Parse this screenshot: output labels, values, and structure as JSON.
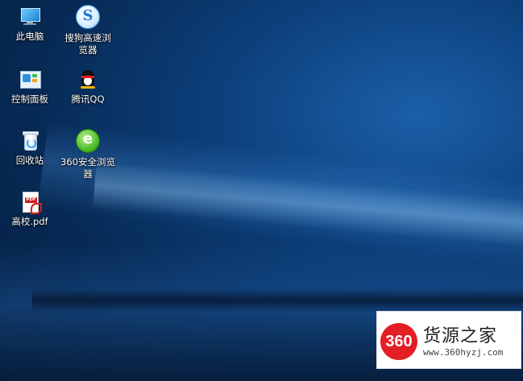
{
  "desktop": {
    "icons": [
      {
        "id": "this-pc",
        "label": "此电脑"
      },
      {
        "id": "sogou-browser",
        "label": "搜狗高速浏览器"
      },
      {
        "id": "control-panel",
        "label": "控制面板"
      },
      {
        "id": "tencent-qq",
        "label": "腾讯QQ",
        "glyph": "QQ"
      },
      {
        "id": "recycle-bin",
        "label": "回收站"
      },
      {
        "id": "browser-360",
        "label": "360安全浏览器",
        "glyph": "e"
      },
      {
        "id": "pdf-file",
        "label": "高校.pdf",
        "glyph": "PDF"
      }
    ],
    "sogou_glyph": "S"
  },
  "watermark": {
    "badge": "360",
    "name": "货源之家",
    "url": "www.360hyzj.com"
  },
  "colors": {
    "wallpaper_base": "#0c3f7a",
    "watermark_red": "#e31e24"
  }
}
